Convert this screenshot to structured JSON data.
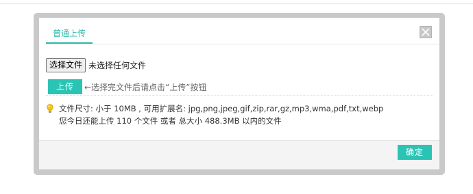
{
  "dialog": {
    "tab_label": "普通上传",
    "close_icon": "close-icon",
    "file_input": {
      "button_label": "选择文件",
      "status_text": "未选择任何文件"
    },
    "upload": {
      "button_label": "上传",
      "hint": "←选择完文件后请点击“上传”按钮"
    },
    "info": {
      "icon": "lightbulb-icon",
      "limits_text": "文件尺寸: 小于 10MB , 可用扩展名: jpg,png,jpeg,gif,zip,rar,gz,mp3,wma,pdf,txt,webp",
      "quota_text": "您今日还能上传 110 个文件 或者 总大小 488.3MB 以内的文件"
    },
    "footer": {
      "ok_label": "确定"
    },
    "colors": {
      "accent": "#2bc4b4",
      "frame": "#c9c9c9"
    }
  }
}
